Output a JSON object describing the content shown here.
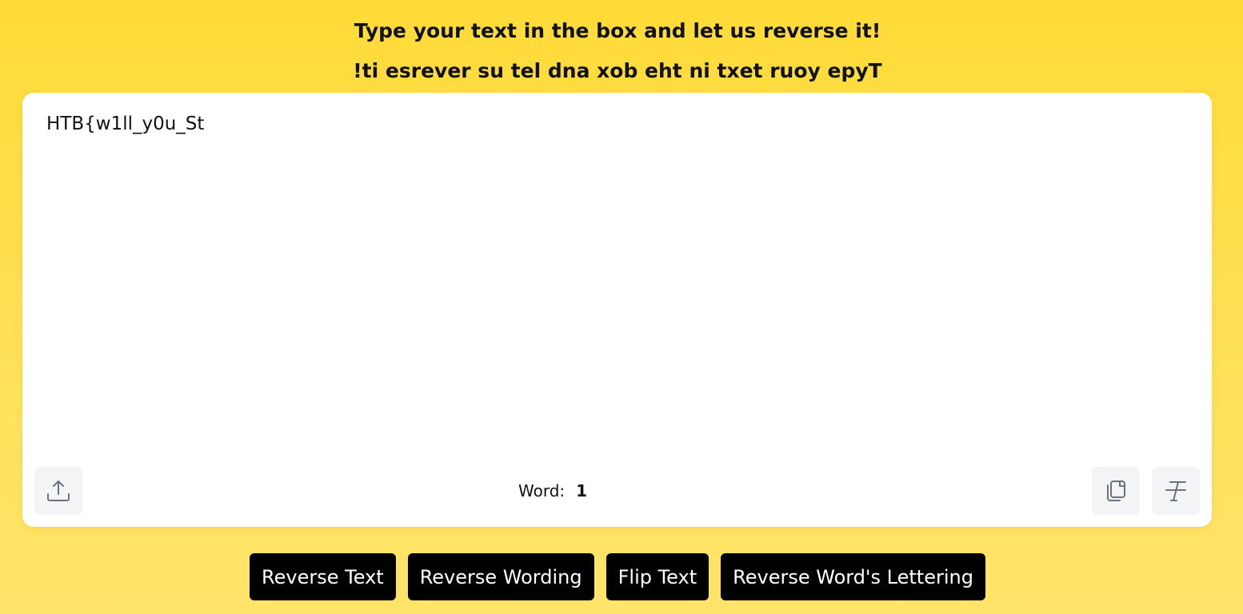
{
  "header": {
    "title": "Type your text in the box and let us reverse it!",
    "title_reversed": "!ti esrever su tel dna xob eht ni txet ruoy epyT"
  },
  "editor": {
    "value": "HTB{w1ll_y0u_St"
  },
  "stats": {
    "word_label": "Word:",
    "word_count": "1"
  },
  "toolbar": {
    "upload_icon": "upload-icon",
    "copy_icon": "copy-icon",
    "clear_format_icon": "clear-format-icon"
  },
  "actions": [
    {
      "label": "Reverse Text"
    },
    {
      "label": "Reverse Wording"
    },
    {
      "label": "Flip Text"
    },
    {
      "label": "Reverse Word's Lettering"
    }
  ],
  "colors": {
    "background": "#ffdb37",
    "button": "#000000",
    "button_text": "#ffffff",
    "icon_button_bg": "#f3f4f6"
  }
}
